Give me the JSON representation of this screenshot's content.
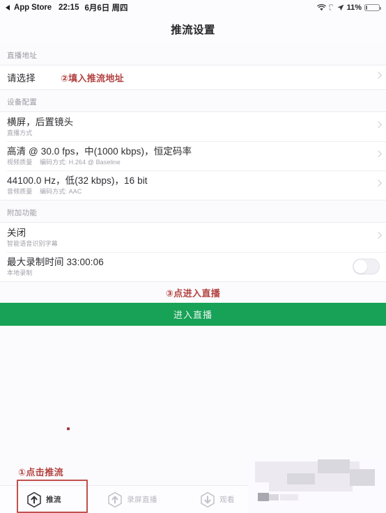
{
  "statusbar": {
    "back_label": "App Store",
    "time": "22:15",
    "date": "6月6日 周四",
    "wifi_icon": "wifi-icon",
    "lock_rotation_icon": "rotation-lock-icon",
    "location_icon": "location-arrow-icon",
    "battery_percent": "11%",
    "battery_icon": "battery-icon"
  },
  "navbar": {
    "title": "推流设置"
  },
  "sections": [
    {
      "header": "直播地址",
      "rows": [
        {
          "title": "请选择",
          "sub": "",
          "sub2": "",
          "annotation": "②填入推流地址",
          "accessory": "chevron"
        }
      ]
    },
    {
      "header": "设备配置",
      "rows": [
        {
          "title": "横屏，后置镜头",
          "sub": "直播方式",
          "sub2": "",
          "annotation": "",
          "accessory": "chevron"
        },
        {
          "title": "高清 @ 30.0 fps，中(1000 kbps)，恒定码率",
          "sub": "视频质量",
          "sub2": "编码方式: H.264 @ Baseline",
          "annotation": "",
          "accessory": "chevron"
        },
        {
          "title": "44100.0 Hz，低(32 kbps)，16 bit",
          "sub": "音频质量",
          "sub2": "编码方式: AAC",
          "annotation": "",
          "accessory": "chevron"
        }
      ]
    },
    {
      "header": "附加功能",
      "rows": [
        {
          "title": "关闭",
          "sub": "智能语音识别字幕",
          "sub2": "",
          "annotation": "",
          "accessory": "chevron"
        },
        {
          "title": "最大录制时间  33:00:06",
          "sub": "本地录制",
          "sub2": "",
          "annotation": "",
          "accessory": "toggle",
          "toggle_on": false
        }
      ]
    }
  ],
  "annotations": {
    "step3": "③点进入直播",
    "step1": "①点击推流"
  },
  "cta": {
    "label": "进入直播",
    "color": "#17a257"
  },
  "tabbar": {
    "items": [
      {
        "label": "推流",
        "icon": "hexagon-arrow-up-icon",
        "active": true
      },
      {
        "label": "录屏直播",
        "icon": "hexagon-arrow-up-icon",
        "active": false
      },
      {
        "label": "观看",
        "icon": "hexagon-arrow-down-icon",
        "active": false
      }
    ]
  },
  "colors": {
    "accent_green": "#17a257",
    "annotation_red": "#b2423f",
    "page_background": "#fbfafc",
    "card_background": "#ffffff"
  }
}
